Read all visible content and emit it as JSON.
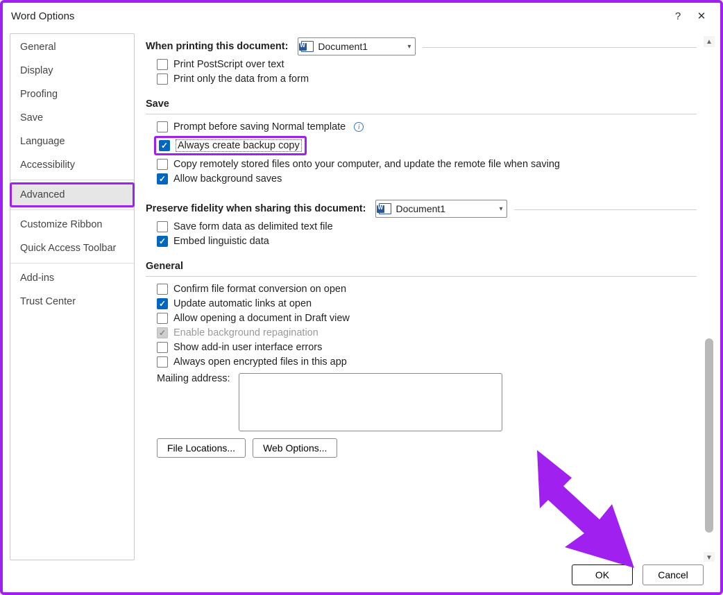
{
  "title": "Word Options",
  "titlebar": {
    "help": "?",
    "close": "✕"
  },
  "sidebar": {
    "items": [
      {
        "label": "General",
        "selected": false
      },
      {
        "label": "Display",
        "selected": false
      },
      {
        "label": "Proofing",
        "selected": false
      },
      {
        "label": "Save",
        "selected": false
      },
      {
        "label": "Language",
        "selected": false
      },
      {
        "label": "Accessibility",
        "selected": false
      },
      {
        "label": "Advanced",
        "selected": true
      },
      {
        "label": "Customize Ribbon",
        "selected": false
      },
      {
        "label": "Quick Access Toolbar",
        "selected": false
      },
      {
        "label": "Add-ins",
        "selected": false
      },
      {
        "label": "Trust Center",
        "selected": false
      }
    ]
  },
  "printing": {
    "header": "When printing this document:",
    "dropdown": "Document1",
    "postscript": {
      "label": "Print PostScript over text",
      "checked": false
    },
    "dataform": {
      "label": "Print only the data from a form",
      "checked": false
    }
  },
  "save": {
    "title": "Save",
    "prompt": {
      "label": "Prompt before saving Normal template",
      "checked": false
    },
    "backup": {
      "label": "Always create backup copy",
      "checked": true
    },
    "remote": {
      "label": "Copy remotely stored files onto your computer, and update the remote file when saving",
      "checked": false
    },
    "bgsave": {
      "label": "Allow background saves",
      "checked": true
    }
  },
  "fidelity": {
    "header": "Preserve fidelity when sharing this document:",
    "dropdown": "Document1",
    "formdata": {
      "label": "Save form data as delimited text file",
      "checked": false
    },
    "linguistic": {
      "label": "Embed linguistic data",
      "checked": true
    }
  },
  "general": {
    "title": "General",
    "confirm": {
      "label": "Confirm file format conversion on open",
      "checked": false
    },
    "autolinks": {
      "label": "Update automatic links at open",
      "checked": true
    },
    "draft": {
      "label": "Allow opening a document in Draft view",
      "checked": false
    },
    "repag": {
      "label": "Enable background repagination",
      "checked": true,
      "disabled": true
    },
    "addin": {
      "label": "Show add-in user interface errors",
      "checked": false
    },
    "encrypted": {
      "label": "Always open encrypted files in this app",
      "checked": false
    },
    "mailing_label": "Mailing address:",
    "mailing_value": "",
    "fileloc": "File Locations...",
    "webopt": "Web Options..."
  },
  "footer": {
    "ok": "OK",
    "cancel": "Cancel"
  }
}
